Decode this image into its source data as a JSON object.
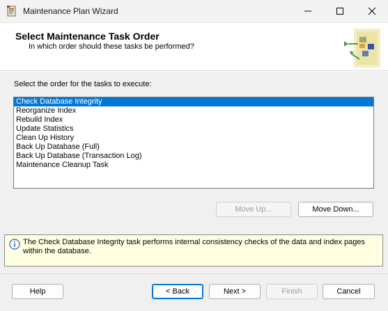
{
  "window": {
    "title": "Maintenance Plan Wizard",
    "app_icon": "wizard-app-icon",
    "controls": [
      "minimize-icon",
      "maximize-icon",
      "close-icon"
    ]
  },
  "header": {
    "title": "Select Maintenance Task Order",
    "subtitle": "In which order should these tasks be performed?",
    "graphic": "wizard-header-graphic"
  },
  "main": {
    "prompt": "Select the order for the tasks to execute:",
    "tasks": [
      "Check Database Integrity",
      "Reorganize Index",
      "Rebuild Index",
      "Update Statistics",
      "Clean Up History",
      "Back Up Database (Full)",
      "Back Up Database (Transaction Log)",
      "Maintenance Cleanup Task"
    ],
    "selected_index": 0,
    "move_up_label": "Move Up...",
    "move_down_label": "Move Down..."
  },
  "info": {
    "icon": "info-icon",
    "text": "The Check Database Integrity task performs internal consistency checks of the data and index pages within the database."
  },
  "footer": {
    "help_label": "Help",
    "back_label": "< Back",
    "next_label": "Next >",
    "finish_label": "Finish",
    "cancel_label": "Cancel"
  },
  "colors": {
    "selection": "#0078d7",
    "info_background": "#ffffe1",
    "dialog_background": "#f0f0f0"
  }
}
